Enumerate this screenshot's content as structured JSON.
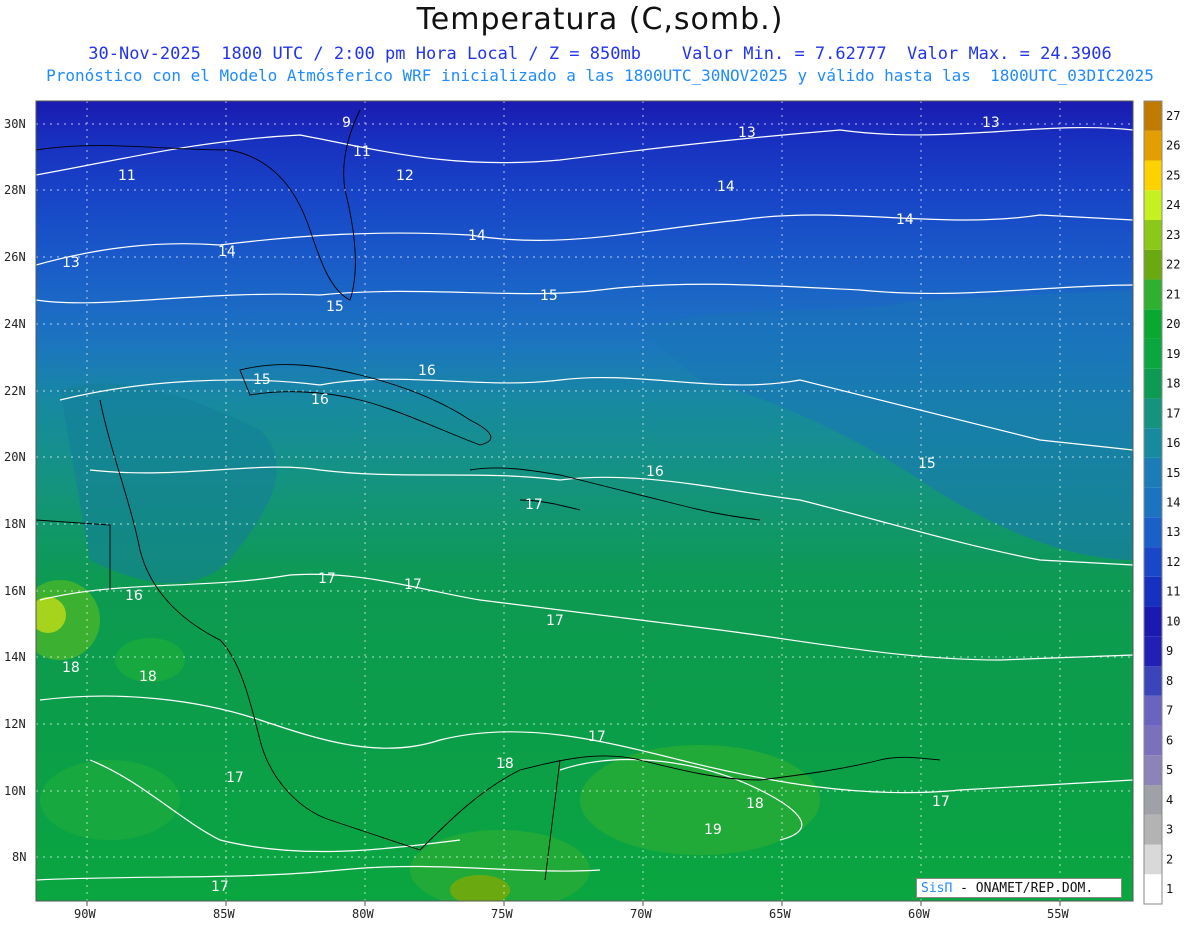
{
  "header": {
    "title": "Temperatura (C,somb.)",
    "subtitle1": "30-Nov-2025  1800 UTC / 2:00 pm Hora Local / Z = 850mb    Valor Min. = 7.62777  Valor Max. = 24.3906",
    "subtitle2": "Pronóstico con el Modelo Atmósferico WRF inicializado a las 1800UTC_30NOV2025 y válido hasta las  1800UTC_03DIC2025"
  },
  "axes": {
    "lon_labels": [
      "90W",
      "85W",
      "80W",
      "75W",
      "70W",
      "65W",
      "60W",
      "55W"
    ],
    "lat_labels": [
      "30N",
      "28N",
      "26N",
      "24N",
      "22N",
      "20N",
      "18N",
      "16N",
      "14N",
      "12N",
      "10N",
      "8N"
    ]
  },
  "colorbar": {
    "levels": [
      "1",
      "2",
      "3",
      "4",
      "5",
      "6",
      "7",
      "8",
      "9",
      "10",
      "11",
      "12",
      "13",
      "14",
      "15",
      "16",
      "17",
      "18",
      "19",
      "20",
      "21",
      "22",
      "23",
      "24",
      "25",
      "26",
      "27"
    ],
    "colors": [
      "#ffffff",
      "#d9d9d9",
      "#b3b3b3",
      "#a0a0a8",
      "#8c84b8",
      "#7a70bc",
      "#6a64c0",
      "#3b44b8",
      "#2220b4",
      "#1a1ab0",
      "#1830c0",
      "#1848c8",
      "#1a60c8",
      "#1c74c0",
      "#1c7cb8",
      "#178aa0",
      "#14947e",
      "#0d9a52",
      "#0aa640",
      "#0aa830",
      "#30b030",
      "#6aaa10",
      "#8cc818",
      "#c6f020",
      "#fcd200",
      "#e39e00",
      "#c07a00"
    ]
  },
  "contour_labels": [
    "9",
    "11",
    "11",
    "12",
    "13",
    "13",
    "13",
    "14",
    "14",
    "14",
    "14",
    "15",
    "15",
    "15",
    "15",
    "16",
    "16",
    "16",
    "16",
    "17",
    "17",
    "17",
    "17",
    "17",
    "17",
    "17",
    "17",
    "18",
    "18",
    "18",
    "18",
    "19"
  ],
  "credit": {
    "brand": "SisΠ",
    "org": "- ONAMET/REP.DOM."
  }
}
